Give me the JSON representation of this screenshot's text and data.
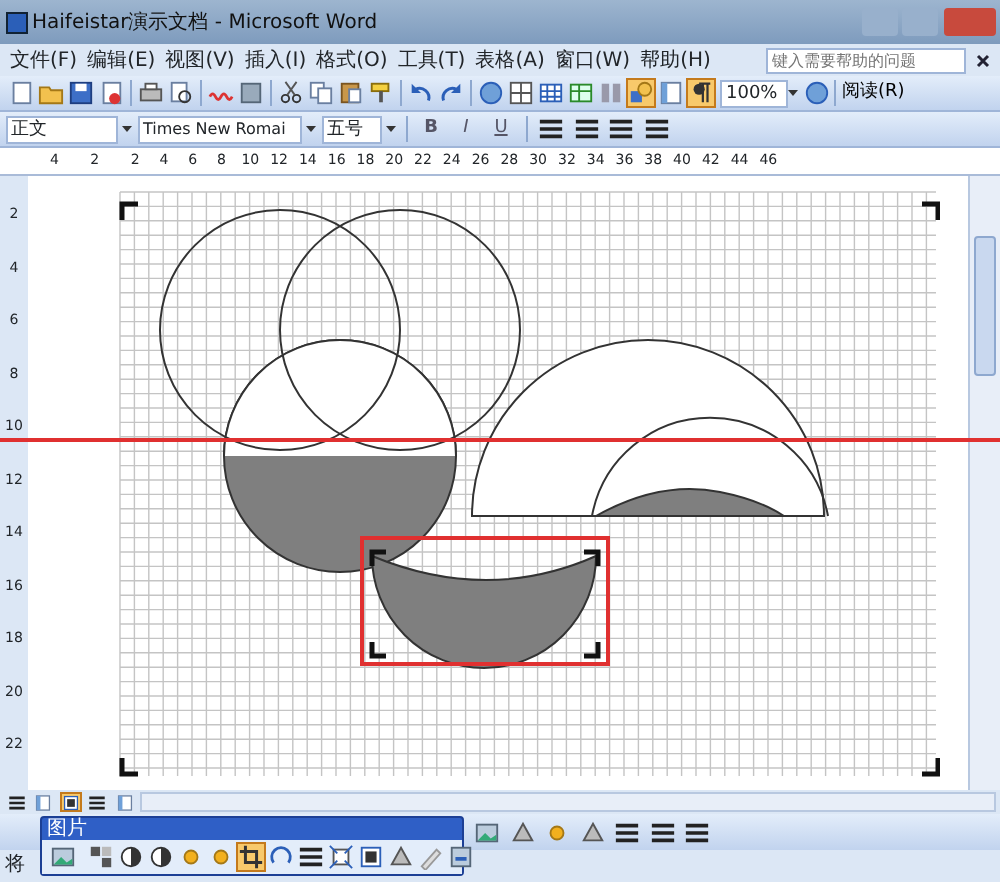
{
  "window": {
    "title": "Haifeistar演示文档 - Microsoft Word"
  },
  "menu": [
    "文件(F)",
    "编辑(E)",
    "视图(V)",
    "插入(I)",
    "格式(O)",
    "工具(T)",
    "表格(A)",
    "窗口(W)",
    "帮助(H)"
  ],
  "help_box": {
    "placeholder": "键入需要帮助的问题"
  },
  "standard_toolbar": [
    {
      "kind": "new",
      "selected": false
    },
    {
      "kind": "open",
      "selected": false
    },
    {
      "kind": "save",
      "selected": false
    },
    {
      "kind": "permission",
      "selected": false
    },
    {
      "kind": "sep"
    },
    {
      "kind": "print",
      "selected": false
    },
    {
      "kind": "preview",
      "selected": false
    },
    {
      "kind": "sep"
    },
    {
      "kind": "spell",
      "selected": false
    },
    {
      "kind": "research",
      "selected": false
    },
    {
      "kind": "sep"
    },
    {
      "kind": "cut",
      "selected": false
    },
    {
      "kind": "copy",
      "selected": false
    },
    {
      "kind": "paste",
      "selected": false
    },
    {
      "kind": "painter",
      "selected": false
    },
    {
      "kind": "sep"
    },
    {
      "kind": "undo",
      "selected": false
    },
    {
      "kind": "redo",
      "selected": false
    },
    {
      "kind": "sep"
    },
    {
      "kind": "link",
      "selected": false
    },
    {
      "kind": "tables",
      "selected": false
    },
    {
      "kind": "table",
      "selected": false
    },
    {
      "kind": "sheet",
      "selected": false
    },
    {
      "kind": "columns",
      "selected": false
    },
    {
      "kind": "drawing",
      "selected": true
    },
    {
      "kind": "docmap",
      "selected": false
    },
    {
      "kind": "marks",
      "selected": true
    }
  ],
  "zoom": {
    "value": "100%"
  },
  "read_button": "阅读(R)",
  "formatting": {
    "style": "正文",
    "font": "Times New Romai",
    "size": "五号",
    "text_buttons": [
      "B",
      "I",
      "U"
    ]
  },
  "ruler": {
    "horizontal": [
      "4",
      "2",
      "2",
      "4",
      "6",
      "8",
      "10",
      "12",
      "14",
      "16",
      "18",
      "20",
      "22",
      "24",
      "26",
      "28",
      "30",
      "32",
      "34",
      "36",
      "38",
      "40",
      "42",
      "44",
      "46"
    ],
    "vertical": [
      "2",
      "4",
      "6",
      "8",
      "10",
      "12",
      "14",
      "16",
      "18",
      "20",
      "22"
    ]
  },
  "picture_toolbar": {
    "title": "图片",
    "buttons": [
      {
        "kind": "picture",
        "selected": false
      },
      {
        "kind": "sep"
      },
      {
        "kind": "color",
        "selected": false
      },
      {
        "kind": "contrast",
        "selected": false
      },
      {
        "kind": "contrast",
        "selected": false
      },
      {
        "kind": "bright",
        "selected": false
      },
      {
        "kind": "bright",
        "selected": false
      },
      {
        "kind": "crop",
        "selected": true
      },
      {
        "kind": "rotate",
        "selected": false
      },
      {
        "kind": "lines",
        "selected": false
      },
      {
        "kind": "compress",
        "selected": false
      },
      {
        "kind": "wrap",
        "selected": false
      },
      {
        "kind": "format",
        "selected": false
      },
      {
        "kind": "pen",
        "selected": false
      },
      {
        "kind": "reset",
        "selected": false
      }
    ]
  },
  "status_bar": {
    "text": "将"
  }
}
